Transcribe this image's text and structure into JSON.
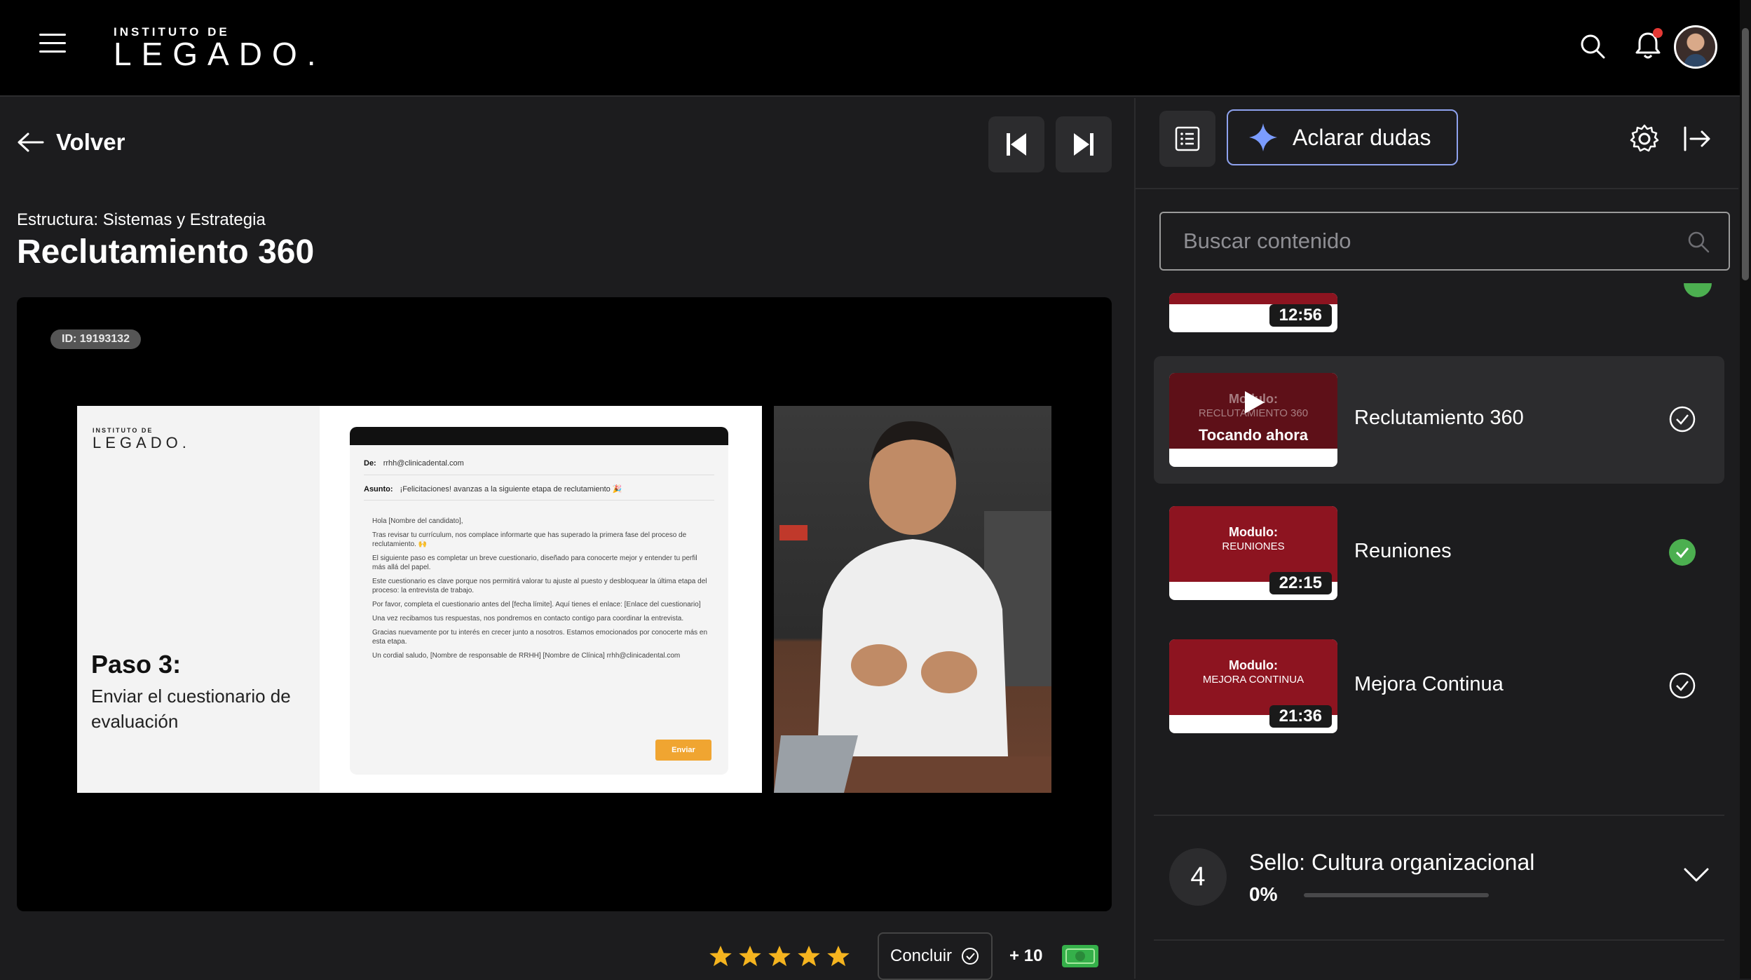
{
  "header": {
    "logo_small": "INSTITUTO DE",
    "logo_big": "LEGADO."
  },
  "nav": {
    "back_label": "Volver"
  },
  "lesson": {
    "breadcrumb": "Estructura: Sistemas y Estrategia",
    "title": "Reclutamiento 360",
    "video_id": "ID: 19193132",
    "slide": {
      "logo_small": "INSTITUTO DE",
      "logo_big": "LEGADO.",
      "step_title": "Paso 3:",
      "step_desc": "Enviar el cuestionario de evaluación",
      "email_from_label": "De:",
      "email_from": "rrhh@clinicadental.com",
      "email_subject_label": "Asunto:",
      "email_subject": "¡Felicitaciones! avanzas a la siguiente etapa de reclutamiento 🎉",
      "email_body": [
        "Hola [Nombre del candidato],",
        "Tras revisar tu currículum, nos complace informarte que has superado la primera fase del proceso de reclutamiento. 🙌",
        "El siguiente paso es completar un breve cuestionario, diseñado para conocerte mejor y entender tu perfil más allá del papel.",
        "Este cuestionario es clave porque nos permitirá valorar tu ajuste al puesto y desbloquear la última etapa del proceso: la entrevista de trabajo.",
        "Por favor, completa el cuestionario antes del [fecha límite]. Aquí tienes el enlace: [Enlace del cuestionario]",
        "Una vez recibamos tus respuestas, nos pondremos en contacto contigo para coordinar la entrevista.",
        "Gracias nuevamente por tu interés en crecer junto a nosotros. Estamos emocionados por conocerte más en esta etapa.",
        "Un cordial saludo, [Nombre de responsable de RRHH] [Nombre de Clínica] rrhh@clinicadental.com"
      ],
      "email_button": "Enviar"
    },
    "rating": 5,
    "conclude_label": "Concluir",
    "points_label": "+ 10"
  },
  "sidebar": {
    "ask_button": "Aclarar dudas",
    "search_placeholder": "Buscar contenido",
    "items": [
      {
        "title": "",
        "duration": "12:56",
        "status": "done"
      },
      {
        "title": "Reclutamiento 360",
        "thumb_line1": "Modulo:",
        "thumb_line2": "RECLUTAMIENTO 360",
        "overlay": "Tocando ahora",
        "status": "current"
      },
      {
        "title": "Reuniones",
        "thumb_line1": "Modulo:",
        "thumb_line2": "REUNIONES",
        "duration": "22:15",
        "status": "done"
      },
      {
        "title": "Mejora Continua",
        "thumb_line1": "Modulo:",
        "thumb_line2": "MEJORA CONTINUA",
        "duration": "21:36",
        "status": "pending"
      }
    ],
    "section": {
      "number": "4",
      "title": "Sello: Cultura organizacional",
      "percent": "0%",
      "progress": 0
    }
  },
  "colors": {
    "accent_border": "#8ea2ee",
    "done_green": "#4caf50",
    "star": "#f5b41f",
    "thumb_red": "#8d1420"
  }
}
